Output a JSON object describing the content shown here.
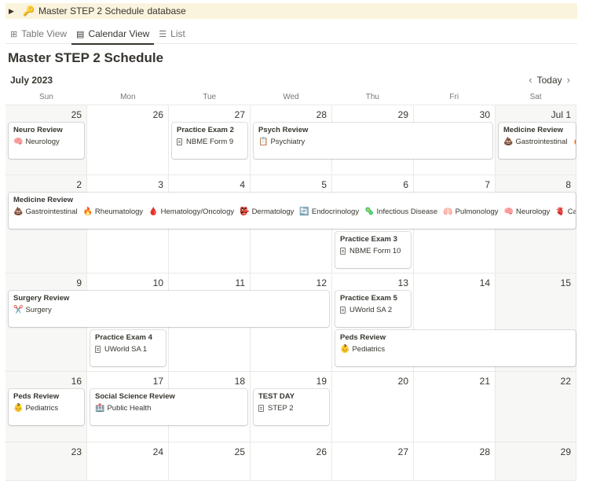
{
  "header": {
    "icon": "key-icon",
    "title": "Master STEP 2 Schedule",
    "suffix": "database"
  },
  "tabs": [
    {
      "label": "Table View",
      "icon": "table-icon"
    },
    {
      "label": "Calendar View",
      "icon": "calendar-icon",
      "active": true
    },
    {
      "label": "List",
      "icon": "list-icon"
    }
  ],
  "page_title": "Master STEP 2 Schedule",
  "calendar": {
    "month": "July 2023",
    "today_label": "Today",
    "weekdays": [
      "Sun",
      "Mon",
      "Tue",
      "Wed",
      "Thu",
      "Fri",
      "Sat"
    ],
    "weeks": [
      [
        "25",
        "26",
        "27",
        "28",
        "29",
        "30",
        "Jul 1"
      ],
      [
        "2",
        "3",
        "4",
        "5",
        "6",
        "7",
        "8"
      ],
      [
        "9",
        "10",
        "11",
        "12",
        "13",
        "14",
        "15"
      ],
      [
        "16",
        "17",
        "18",
        "19",
        "20",
        "21",
        "22"
      ],
      [
        "23",
        "24",
        "25",
        "26",
        "27",
        "28",
        "29"
      ]
    ]
  },
  "events": [
    {
      "title": "Neuro Review",
      "props": [
        {
          "emoji": "🧠",
          "text": "Neurology"
        }
      ]
    },
    {
      "title": "Practice Exam 2",
      "props": [
        {
          "doc": true,
          "text": "NBME Form 9"
        }
      ]
    },
    {
      "title": "Psych Review",
      "props": [
        {
          "emoji": "📋",
          "text": "Psychiatry"
        }
      ]
    },
    {
      "title": "Medicine Review",
      "props": [
        {
          "emoji": "💩",
          "text": "Gastrointestinal"
        },
        {
          "emoji": "🔥",
          "text": ""
        }
      ]
    },
    {
      "title": "Medicine Review",
      "props": [
        {
          "emoji": "💩",
          "text": "Gastrointestinal"
        },
        {
          "emoji": "🔥",
          "text": "Rheumatology"
        },
        {
          "emoji": "🩸",
          "text": "Hematology/Oncology"
        },
        {
          "emoji": "👺",
          "text": "Dermatology"
        },
        {
          "emoji": "🔄",
          "text": "Endocrinology"
        },
        {
          "emoji": "🦠",
          "text": "Infectious Disease"
        },
        {
          "emoji": "🫁",
          "text": "Pulmonology"
        },
        {
          "emoji": "🧠",
          "text": "Neurology"
        },
        {
          "emoji": "🫀",
          "text": "Cardiology"
        }
      ]
    },
    {
      "title": "Practice Exam 3",
      "props": [
        {
          "doc": true,
          "text": "NBME Form 10"
        }
      ]
    },
    {
      "title": "Surgery Review",
      "props": [
        {
          "emoji": "✂️",
          "text": "Surgery"
        }
      ]
    },
    {
      "title": "Practice Exam 5",
      "props": [
        {
          "doc": true,
          "text": "UWorld SA 2"
        }
      ]
    },
    {
      "title": "Practice Exam 4",
      "props": [
        {
          "doc": true,
          "text": "UWorld SA 1"
        }
      ]
    },
    {
      "title": "Peds Review",
      "props": [
        {
          "emoji": "👶",
          "text": "Pediatrics"
        }
      ]
    },
    {
      "title": "Peds Review",
      "props": [
        {
          "emoji": "👶",
          "text": "Pediatrics"
        }
      ]
    },
    {
      "title": "Social Science Review",
      "props": [
        {
          "emoji": "🏥",
          "text": "Public Health"
        }
      ]
    },
    {
      "title": "TEST DAY",
      "props": [
        {
          "doc": true,
          "text": "STEP 2"
        }
      ]
    }
  ]
}
